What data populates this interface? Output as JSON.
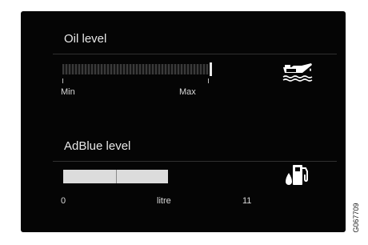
{
  "oil": {
    "title": "Oil level",
    "min_label": "Min",
    "max_label": "Max",
    "icon": "oil-can-icon"
  },
  "adblue": {
    "title": "AdBlue level",
    "scale_start": "0",
    "unit_label": "litre",
    "scale_end": "11",
    "level_fraction": 1.0,
    "icon": "fuel-pump-icon"
  },
  "figure_code": "G067709",
  "colors": {
    "panel_background": "#050505",
    "text": "#e8e8e8",
    "gauge_fill": "#dcdcdc"
  }
}
